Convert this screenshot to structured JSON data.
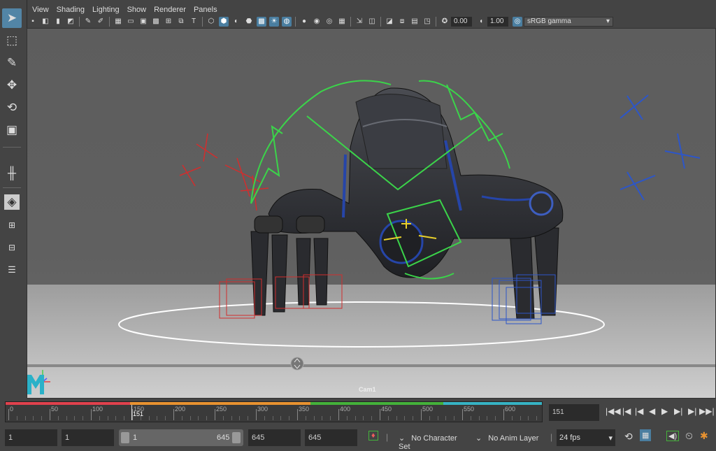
{
  "menu": [
    "View",
    "Shading",
    "Lighting",
    "Show",
    "Renderer",
    "Panels"
  ],
  "iconbar": {
    "exposure_value": "0.00",
    "gamma_value": "1.00",
    "color_space": "sRGB gamma"
  },
  "viewport": {
    "camera_label": "Cam1",
    "axis_y": "Y",
    "axis_x": "X",
    "logo": "M"
  },
  "timeline": {
    "ticks": [
      "0",
      "50",
      "100",
      "150",
      "200",
      "250",
      "300",
      "350",
      "400",
      "450",
      "500",
      "550",
      "600"
    ],
    "current_frame": "151",
    "current_frame_field": "151",
    "colors": {
      "red": "#e0414d",
      "orange": "#e89230",
      "green": "#44b23a",
      "cyan": "#36b3c4"
    }
  },
  "range": {
    "start": "1",
    "playback_start": "1",
    "slider_start": "1",
    "slider_end": "645",
    "playback_end": "645",
    "end": "645",
    "character_set": "No Character Set",
    "anim_layer": "No Anim Layer",
    "fps": "24 fps"
  },
  "playback_icons": [
    "go-to-start-icon",
    "step-back-key-icon",
    "step-back-frame-icon",
    "play-backward-icon",
    "play-forward-icon",
    "step-forward-frame-icon",
    "step-forward-key-icon",
    "go-to-end-icon"
  ]
}
